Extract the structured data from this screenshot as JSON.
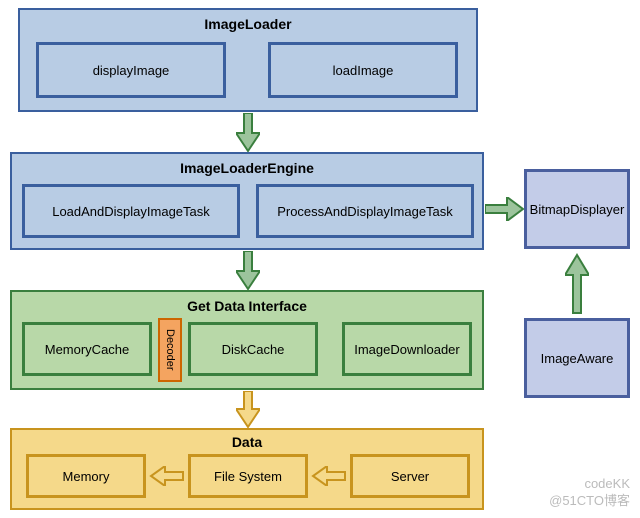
{
  "imageLoader": {
    "title": "ImageLoader",
    "left": "displayImage",
    "right": "loadImage"
  },
  "engine": {
    "title": "ImageLoaderEngine",
    "left": "LoadAndDisplayImageTask",
    "right": "ProcessAndDisplayImageTask"
  },
  "side": {
    "displayer": "BitmapDisplayer",
    "aware": "ImageAware"
  },
  "getData": {
    "title": "Get Data Interface",
    "memory": "MemoryCache",
    "decoder": "Decoder",
    "disk": "DiskCache",
    "downloader": "ImageDownloader"
  },
  "data": {
    "title": "Data",
    "memory": "Memory",
    "fs": "File System",
    "server": "Server"
  },
  "watermark": {
    "line1": "codeKK",
    "line2": "@51CTO博客"
  }
}
